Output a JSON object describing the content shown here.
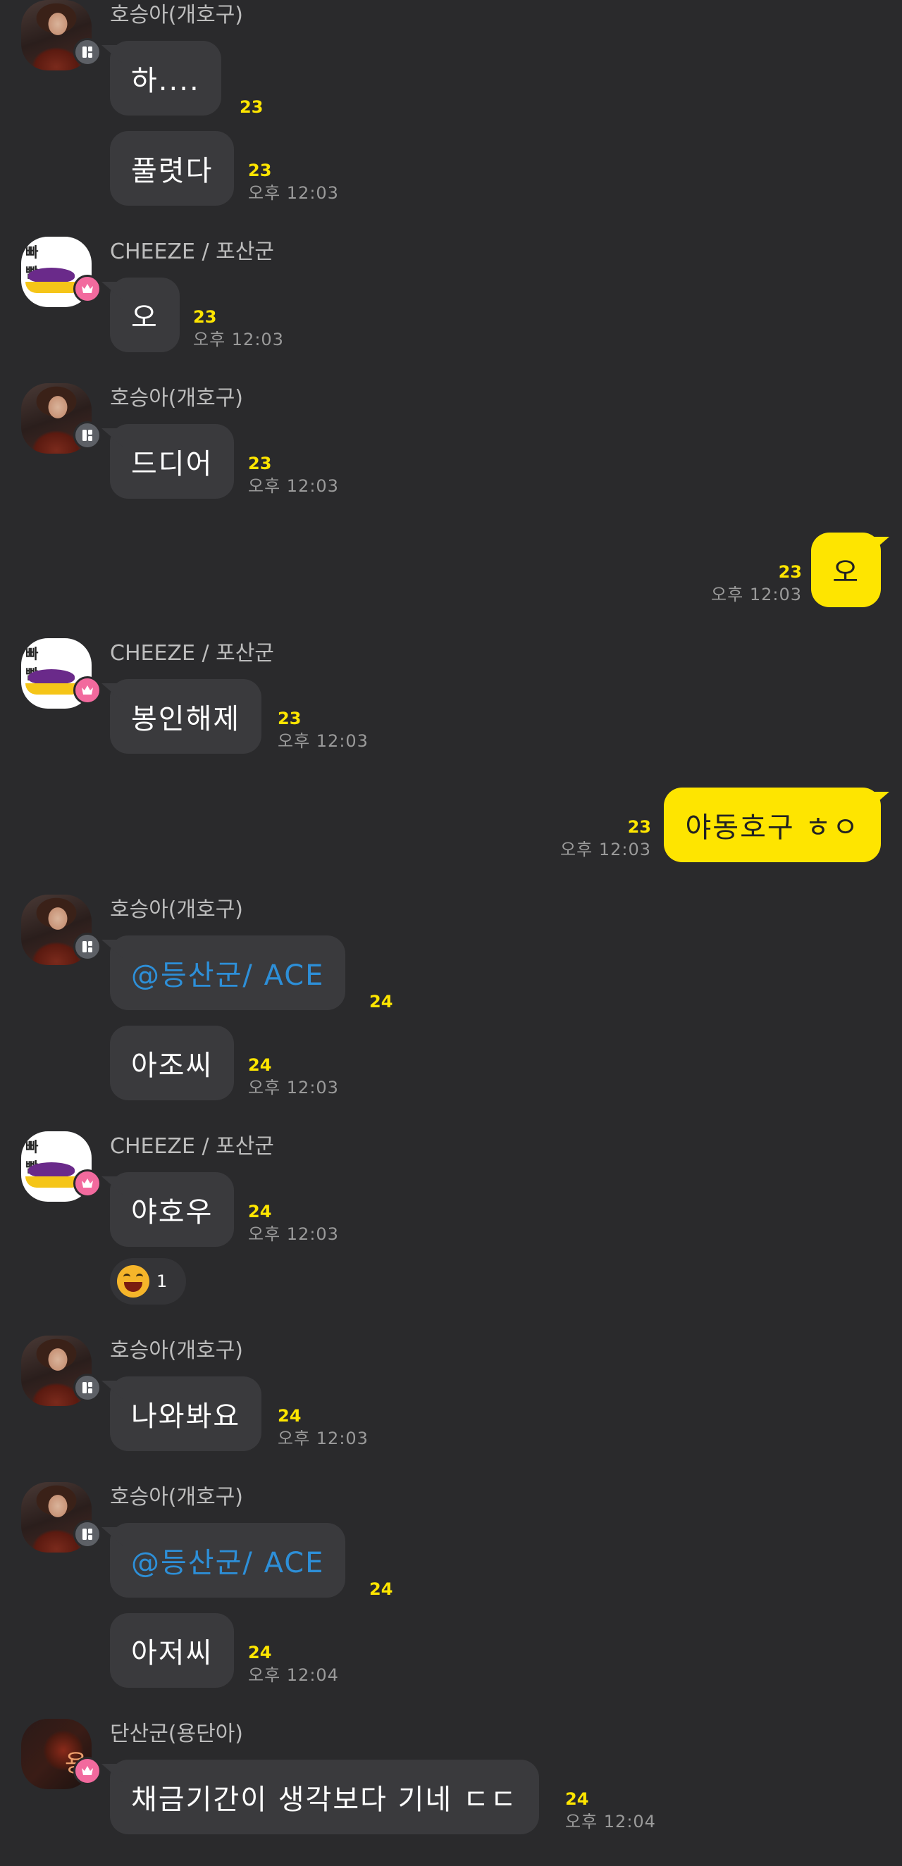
{
  "colors": {
    "background": "#2a2a2c",
    "bubble_other": "#3a3a3d",
    "bubble_mine": "#fee500",
    "unread_count": "#fee500",
    "mention": "#2d8fd8",
    "time": "#9a9a9a"
  },
  "groups": [
    {
      "sender": "호승아(개호구)",
      "avatar": "warrior-avatar",
      "badge": "manager-badge-icon",
      "messages": [
        {
          "text": "하....",
          "count": "23",
          "time": ""
        },
        {
          "text": "풀렷다",
          "count": "23",
          "time": "오후 12:03"
        }
      ]
    },
    {
      "sender": "CHEEZE / 포산군",
      "avatar": "duck-avatar",
      "badge": "crown-badge-icon",
      "messages": [
        {
          "text": "오",
          "count": "23",
          "time": "오후 12:03"
        }
      ]
    },
    {
      "sender": "호승아(개호구)",
      "avatar": "warrior-avatar",
      "badge": "manager-badge-icon",
      "messages": [
        {
          "text": "드디어",
          "count": "23",
          "time": "오후 12:03"
        }
      ]
    },
    {
      "mine": true,
      "messages": [
        {
          "text": "오",
          "count": "23",
          "time": "오후 12:03"
        }
      ]
    },
    {
      "sender": "CHEEZE / 포산군",
      "avatar": "duck-avatar",
      "badge": "crown-badge-icon",
      "messages": [
        {
          "text": "봉인해제",
          "count": "23",
          "time": "오후 12:03"
        }
      ]
    },
    {
      "mine": true,
      "messages": [
        {
          "text": "야동호구 ㅎㅇ",
          "count": "23",
          "time": "오후 12:03"
        }
      ]
    },
    {
      "sender": "호승아(개호구)",
      "avatar": "warrior-avatar",
      "badge": "manager-badge-icon",
      "messages": [
        {
          "text": "@등산군/ ACE",
          "count": "24",
          "time": "",
          "mention": true
        },
        {
          "text": "아조씨",
          "count": "24",
          "time": "오후 12:03"
        }
      ]
    },
    {
      "sender": "CHEEZE / 포산군",
      "avatar": "duck-avatar",
      "badge": "crown-badge-icon",
      "messages": [
        {
          "text": "야호우",
          "count": "24",
          "time": "오후 12:03"
        }
      ],
      "reaction": {
        "emoji": "laughing-emoji-icon",
        "count": "1"
      }
    },
    {
      "sender": "호승아(개호구)",
      "avatar": "warrior-avatar",
      "badge": "manager-badge-icon",
      "messages": [
        {
          "text": "나와봐요",
          "count": "24",
          "time": "오후 12:03"
        }
      ]
    },
    {
      "sender": "호승아(개호구)",
      "avatar": "warrior-avatar",
      "badge": "manager-badge-icon",
      "messages": [
        {
          "text": "@등산군/ ACE",
          "count": "24",
          "time": "",
          "mention": true
        },
        {
          "text": "아저씨",
          "count": "24",
          "time": "오후 12:04"
        }
      ]
    },
    {
      "sender": "단산군(용단아)",
      "avatar": "dragon-avatar",
      "badge": "crown-badge-icon",
      "messages": [
        {
          "text": "채금기간이 생각보다 기네 ㄷㄷ",
          "count": "24",
          "time": "오후 12:04"
        }
      ]
    }
  ]
}
